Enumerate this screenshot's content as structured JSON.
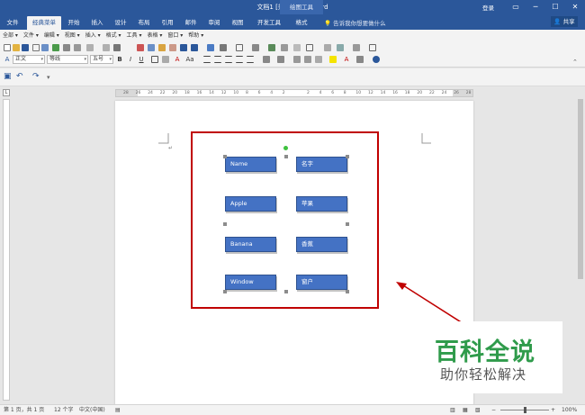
{
  "window": {
    "title": "文档1 [兼容模式] - Word",
    "context_tab": "绘图工具",
    "login": "登录",
    "controls": [
      "▭",
      "─",
      "☐",
      "✕"
    ]
  },
  "tabs": [
    {
      "label": "文件"
    },
    {
      "label": "经典菜单"
    },
    {
      "label": "开始"
    },
    {
      "label": "插入"
    },
    {
      "label": "设计"
    },
    {
      "label": "布局"
    },
    {
      "label": "引用"
    },
    {
      "label": "邮件"
    },
    {
      "label": "审阅"
    },
    {
      "label": "视图"
    },
    {
      "label": "开发工具"
    },
    {
      "label": "格式"
    }
  ],
  "tell_me": "告诉我你想要做什么",
  "share": "共享",
  "classic_menu": [
    "全部 ▾",
    "文件 ▾",
    "编辑 ▾",
    "视图 ▾",
    "插入 ▾",
    "格式 ▾",
    "工具 ▾",
    "表格 ▾",
    "窗口 ▾",
    "帮助 ▾"
  ],
  "format_bar": {
    "style": "正文",
    "font": "等线",
    "size": "五号",
    "bold": "B",
    "italic": "I",
    "underline": "U",
    "font_color_letter": "A",
    "change_case": "Aa"
  },
  "ruler": {
    "ticks": [
      "28",
      "26",
      "24",
      "22",
      "20",
      "18",
      "16",
      "14",
      "12",
      "10",
      "8",
      "6",
      "4",
      "2",
      "",
      "2",
      "4",
      "6",
      "8",
      "10",
      "12",
      "14",
      "16",
      "18",
      "20",
      "22",
      "24",
      "26",
      "28"
    ]
  },
  "document": {
    "fields_left": [
      "Name",
      "Apple",
      "Banana",
      "Window"
    ],
    "fields_right": [
      "名字",
      "苹果",
      "香蕉",
      "窗户"
    ]
  },
  "status_bar": {
    "page": "第 1 页，共 1 页",
    "words": "12 个字",
    "language": "中文(中国)",
    "zoom": "100%"
  },
  "watermark": {
    "title": "百科全说",
    "subtitle": "助你轻松解决"
  },
  "colors": {
    "accent": "#2b579a",
    "field_fill": "#4472c4",
    "selection": "#c00000",
    "watermark_green": "#2f9b4b"
  }
}
